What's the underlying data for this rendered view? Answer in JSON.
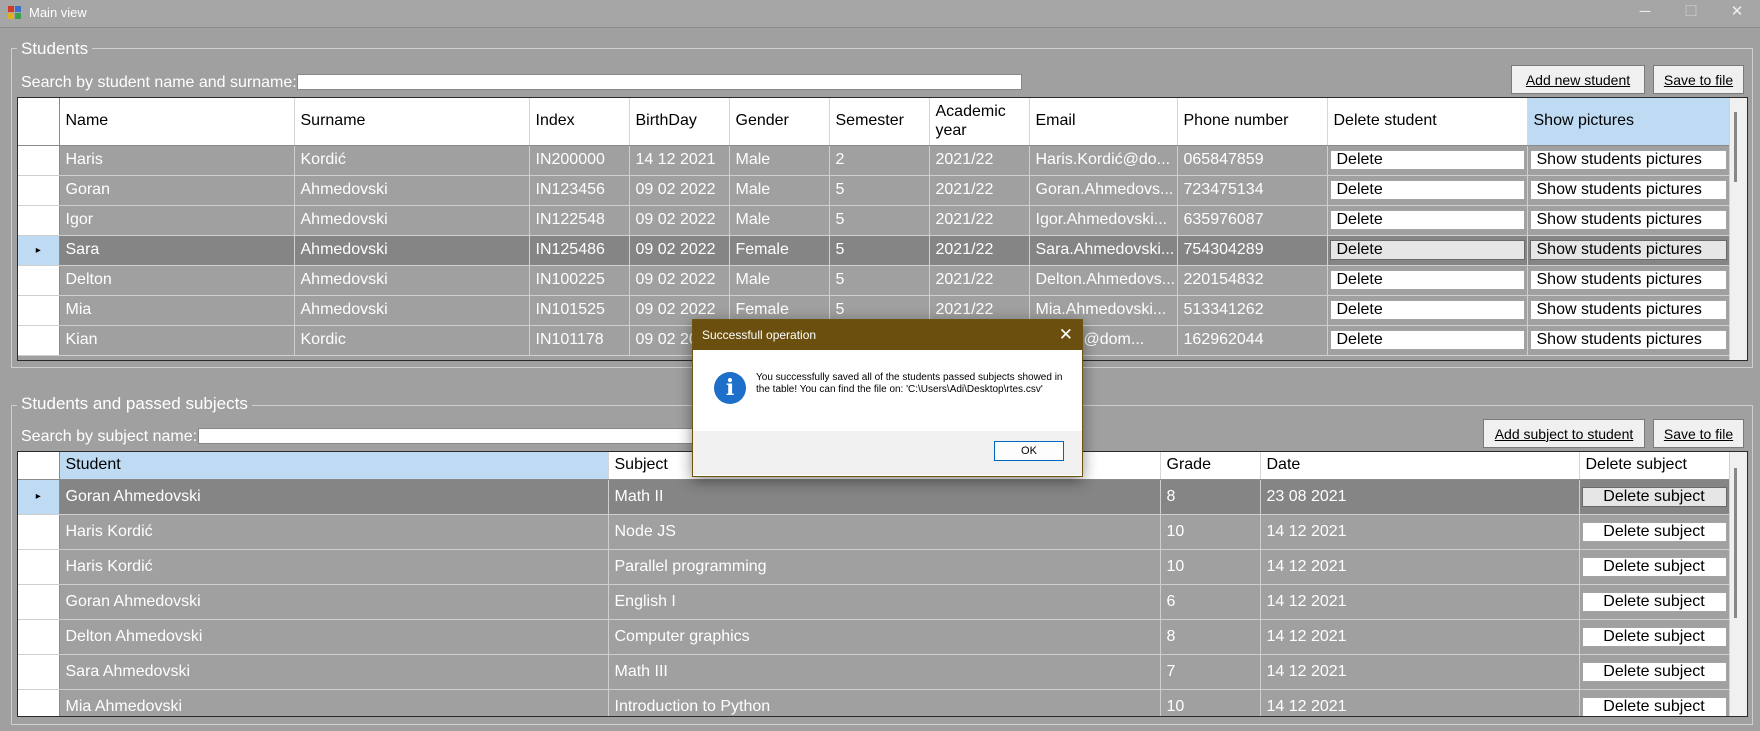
{
  "window": {
    "title": "Main view",
    "minimize_glyph": "─",
    "maximize_glyph": "☐",
    "close_glyph": "✕"
  },
  "students_group": {
    "title": "Students",
    "search_label": "Search by student name and surname:",
    "search_value": "",
    "add_button": "Add new student",
    "save_button": "Save to file",
    "columns": [
      "Name",
      "Surname",
      "Index",
      "BirthDay",
      "Gender",
      "Semester",
      "Academic year",
      "Email",
      "Phone number",
      "Delete student",
      "Show pictures"
    ],
    "delete_label": "Delete",
    "pictures_label": "Show students pictures",
    "selected_row": 3,
    "rows": [
      {
        "name": "Haris",
        "surname": "Kordić",
        "index": "IN200000",
        "birthday": "14 12 2021",
        "gender": "Male",
        "semester": "2",
        "year": "2021/22",
        "email": "Haris.Kordić@do...",
        "phone": "065847859"
      },
      {
        "name": "Goran",
        "surname": "Ahmedovski",
        "index": "IN123456",
        "birthday": "09 02 2022",
        "gender": "Male",
        "semester": "5",
        "year": "2021/22",
        "email": "Goran.Ahmedovs...",
        "phone": "723475134"
      },
      {
        "name": "Igor",
        "surname": "Ahmedovski",
        "index": "IN122548",
        "birthday": "09 02 2022",
        "gender": "Male",
        "semester": "5",
        "year": "2021/22",
        "email": "Igor.Ahmedovski...",
        "phone": "635976087"
      },
      {
        "name": "Sara",
        "surname": "Ahmedovski",
        "index": "IN125486",
        "birthday": "09 02 2022",
        "gender": "Female",
        "semester": "5",
        "year": "2021/22",
        "email": "Sara.Ahmedovski...",
        "phone": "754304289"
      },
      {
        "name": "Delton",
        "surname": "Ahmedovski",
        "index": "IN100225",
        "birthday": "09 02 2022",
        "gender": "Male",
        "semester": "5",
        "year": "2021/22",
        "email": "Delton.Ahmedovs...",
        "phone": "220154832"
      },
      {
        "name": "Mia",
        "surname": "Ahmedovski",
        "index": "IN101525",
        "birthday": "09 02 2022",
        "gender": "Female",
        "semester": "5",
        "year": "2021/22",
        "email": "Mia.Ahmedovski...",
        "phone": "513341262"
      },
      {
        "name": "Kian",
        "surname": "Kordic",
        "index": "IN101178",
        "birthday": "09 02 20",
        "gender": "",
        "semester": "",
        "year": "",
        "email": "...ordic@dom...",
        "phone": "162962044"
      }
    ]
  },
  "subjects_group": {
    "title": "Students and passed subjects",
    "search_label": "Search by subject name:",
    "search_value": "",
    "add_button": "Add subject to student",
    "save_button": "Save to file",
    "columns": [
      "Student",
      "Subject",
      "Grade",
      "Date",
      "Delete subject"
    ],
    "delete_label": "Delete subject",
    "selected_row": 0,
    "rows": [
      {
        "student": "Goran Ahmedovski",
        "subject": "Math II",
        "grade": "8",
        "date": "23 08 2021"
      },
      {
        "student": "Haris Kordić",
        "subject": "Node JS",
        "grade": "10",
        "date": "14 12 2021"
      },
      {
        "student": "Haris Kordić",
        "subject": "Parallel programming",
        "grade": "10",
        "date": "14 12 2021"
      },
      {
        "student": "Goran Ahmedovski",
        "subject": "English I",
        "grade": "6",
        "date": "14 12 2021"
      },
      {
        "student": "Delton Ahmedovski",
        "subject": "Computer graphics",
        "grade": "8",
        "date": "14 12 2021"
      },
      {
        "student": "Sara Ahmedovski",
        "subject": "Math III",
        "grade": "7",
        "date": "14 12 2021"
      },
      {
        "student": "Mia Ahmedovski",
        "subject": "Introduction to Python",
        "grade": "10",
        "date": "14 12 2021"
      }
    ]
  },
  "dialog": {
    "title": "Successfull operation",
    "close_glyph": "✕",
    "icon_glyph": "i",
    "message": "You successfully saved all of the students passed subjects showed in the table! You can find the file on: 'C:\\Users\\Adi\\Desktop\\rtes.csv'",
    "ok_button": "OK"
  },
  "row_marker_glyph": "▸",
  "colors": {
    "background": "#a0a0a0",
    "selection": "#858585",
    "header_highlight": "#bfdbf3",
    "dialog_title": "#6b4f0f",
    "info_icon": "#1d6fc9"
  }
}
